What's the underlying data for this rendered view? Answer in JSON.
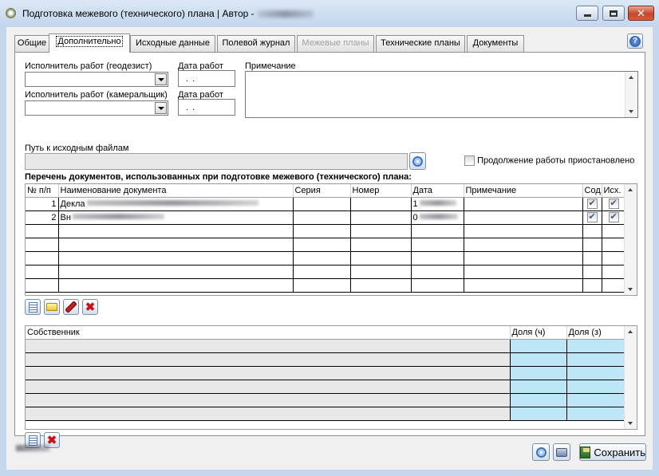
{
  "window": {
    "title": "Подготовка межевого (технического) плана | Автор -"
  },
  "tabs": [
    {
      "label": "Общие"
    },
    {
      "label": "Дополнительно"
    },
    {
      "label": "Исходные данные"
    },
    {
      "label": "Полевой журнал"
    },
    {
      "label": "Межевые планы"
    },
    {
      "label": "Технические планы"
    },
    {
      "label": "Документы"
    }
  ],
  "form": {
    "executor_geodesist_label": "Исполнитель работ (геодезист)",
    "executor_office_label": "Исполнитель работ (камеральщик)",
    "work_date_label_1": "Дата работ",
    "work_date_label_2": "Дата работ",
    "date_value_1": ". .",
    "date_value_2": ". .",
    "note_label": "Примечание",
    "source_path_label": "Путь к исходным файлам",
    "suspended_label": "Продолжение работы приостановлено",
    "doc_list_title": "Перечень документов, использованных при подготовке межевого (технического) плана:"
  },
  "documents": {
    "columns": [
      "№ п/п",
      "Наименование документа",
      "Серия",
      "Номер",
      "Дата",
      "Примечание",
      "Сод.",
      "Исх."
    ],
    "rows": [
      {
        "num": "1",
        "name": "Декла",
        "date": "1"
      },
      {
        "num": "2",
        "name": "Вн",
        "date": "0"
      }
    ]
  },
  "owners": {
    "columns": [
      "Собственник",
      "Доля (ч)",
      "Доля (з)"
    ]
  },
  "footer": {
    "save_label": "Сохранить"
  },
  "icons": {
    "help": "help-icon",
    "add": "add-document-icon",
    "open": "folder-icon",
    "edit": "pencil-icon",
    "delete": "delete-x-icon",
    "settings": "disc-icon",
    "print": "printer-icon",
    "save": "save-icon"
  },
  "colors": {
    "share_cell": "#bde6f7",
    "delete_red": "#d01010"
  }
}
